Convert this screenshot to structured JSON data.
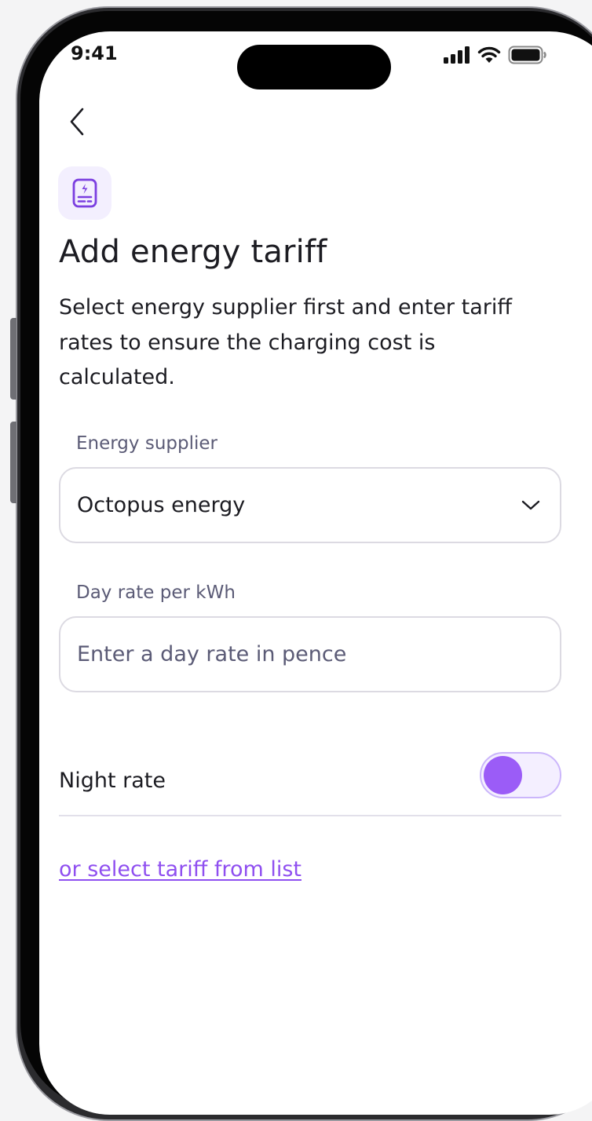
{
  "status_bar": {
    "time": "9:41",
    "icons": [
      "signal-icon",
      "wifi-icon",
      "battery-icon"
    ]
  },
  "nav": {
    "back_icon": "chevron-left-icon"
  },
  "header": {
    "icon": "tariff-document-icon",
    "title": "Add energy tariff",
    "subtitle": "Select energy supplier first and enter tariff rates to ensure the charging cost is calculated."
  },
  "form": {
    "supplier": {
      "label": "Energy supplier",
      "value": "Octopus energy",
      "icon": "chevron-down-icon"
    },
    "day_rate": {
      "label": "Day rate per kWh",
      "value": "",
      "placeholder": "Enter a day rate in pence"
    },
    "night_rate": {
      "label": "Night rate",
      "enabled": false
    }
  },
  "link": {
    "label": "or select tariff from list"
  },
  "colors": {
    "accent": "#9b5cf7",
    "link": "#8f4ff0",
    "icon_bg": "#f3effe",
    "border": "#dcdae2",
    "label": "#5b5b76",
    "text": "#1c1c22"
  }
}
